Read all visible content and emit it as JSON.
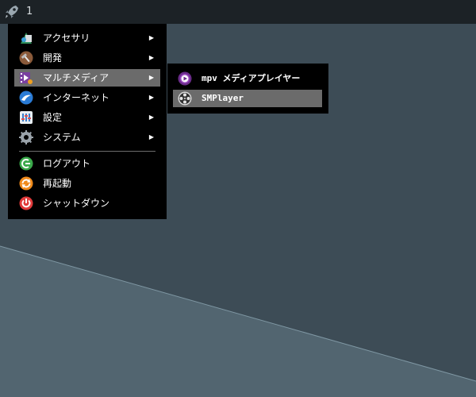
{
  "panel": {
    "launcher_icon": "rocket-icon",
    "workspace": "1"
  },
  "main_menu": {
    "items": [
      {
        "label": "アクセサリ",
        "icon": "accessories-icon",
        "has_submenu": true
      },
      {
        "label": "開発",
        "icon": "development-icon",
        "has_submenu": true
      },
      {
        "label": "マルチメディア",
        "icon": "multimedia-icon",
        "has_submenu": true,
        "active": true
      },
      {
        "label": "インターネット",
        "icon": "internet-icon",
        "has_submenu": true
      },
      {
        "label": "設定",
        "icon": "settings-icon",
        "has_submenu": true
      },
      {
        "label": "システム",
        "icon": "system-gear-icon",
        "has_submenu": true
      }
    ],
    "actions": [
      {
        "label": "ログアウト",
        "icon": "logout-icon"
      },
      {
        "label": "再起動",
        "icon": "reboot-icon"
      },
      {
        "label": "シャットダウン",
        "icon": "power-icon"
      }
    ],
    "submenu_arrow": "▶"
  },
  "multimedia_submenu": {
    "items": [
      {
        "label": "mpv メディアプレイヤー",
        "icon": "mpv-icon"
      },
      {
        "label": "SMPlayer",
        "icon": "smplayer-icon",
        "active": true
      }
    ]
  },
  "colors": {
    "panel": "#1c2226",
    "desktop": "#3f4f5a",
    "menu_background": "#000000",
    "menu_highlight": "#6b6b6b"
  }
}
